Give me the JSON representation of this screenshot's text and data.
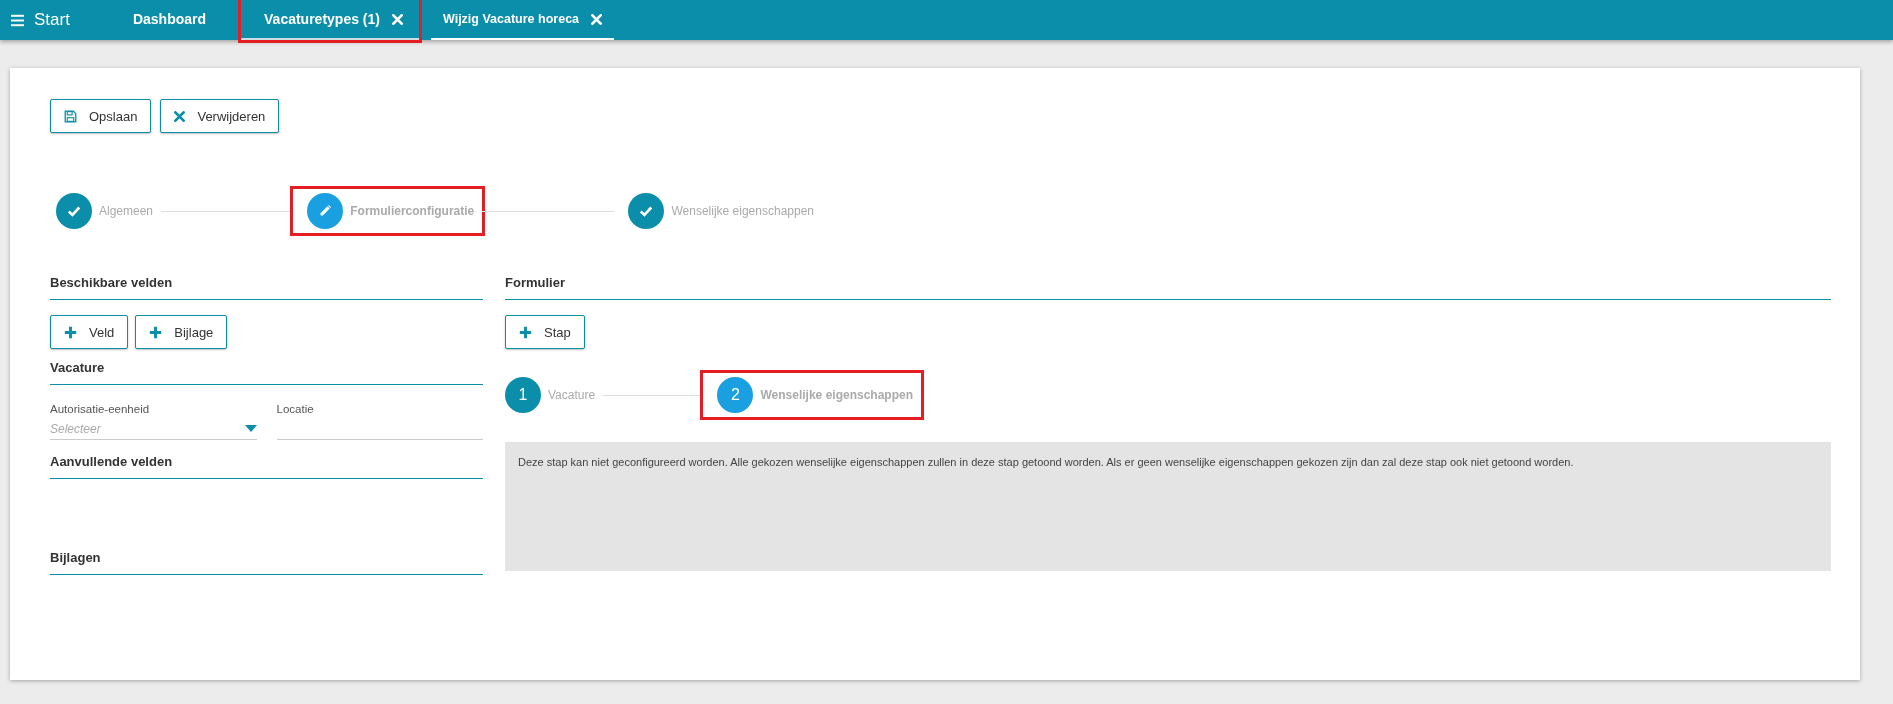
{
  "topbar": {
    "menu_label": "Start",
    "tabs": [
      {
        "label": "Dashboard",
        "selected": false,
        "closable": false,
        "highlighted": false
      },
      {
        "label": "Vacaturetypes (1)",
        "selected": false,
        "closable": true,
        "highlighted": true
      },
      {
        "label": "Wijzig Vacature horeca",
        "selected": true,
        "closable": true,
        "highlighted": false
      }
    ]
  },
  "toolbar": [
    {
      "label": "Opslaan"
    },
    {
      "label": "Verwijderen"
    }
  ],
  "wizard": [
    {
      "label": "Algemeen",
      "kind": "done",
      "highlighted": false
    },
    {
      "label": "Formulierconfiguratie",
      "kind": "current",
      "highlighted": true
    },
    {
      "label": "Wenselijke eigenschappen",
      "kind": "done",
      "highlighted": false
    }
  ],
  "available_fields": {
    "title": "Beschikbare velden",
    "buttons": [
      "Veld",
      "Bijlage"
    ],
    "sections": [
      {
        "title": "Vacature",
        "fields": [
          {
            "label": "Autorisatie-eenheid",
            "kind": "select",
            "placeholder": "Selecteer"
          },
          {
            "label": "Locatie",
            "kind": "text"
          }
        ]
      },
      {
        "title": "Aanvullende velden"
      },
      {
        "title": "Bijlagen"
      }
    ]
  },
  "form": {
    "title": "Formulier",
    "button": "Stap",
    "steps": [
      {
        "number": "1",
        "label": "Vacature",
        "selected": false,
        "highlighted": false
      },
      {
        "number": "2",
        "label": "Wenselijke eigenschappen",
        "selected": true,
        "highlighted": true
      }
    ],
    "message": "Deze stap kan niet geconfigureerd worden. Alle gekozen wenselijke eigenschappen zullen in deze stap getoond worden. Als er geen wenselijke eigenschappen gekozen zijn dan zal deze stap ook niet getoond worden."
  }
}
